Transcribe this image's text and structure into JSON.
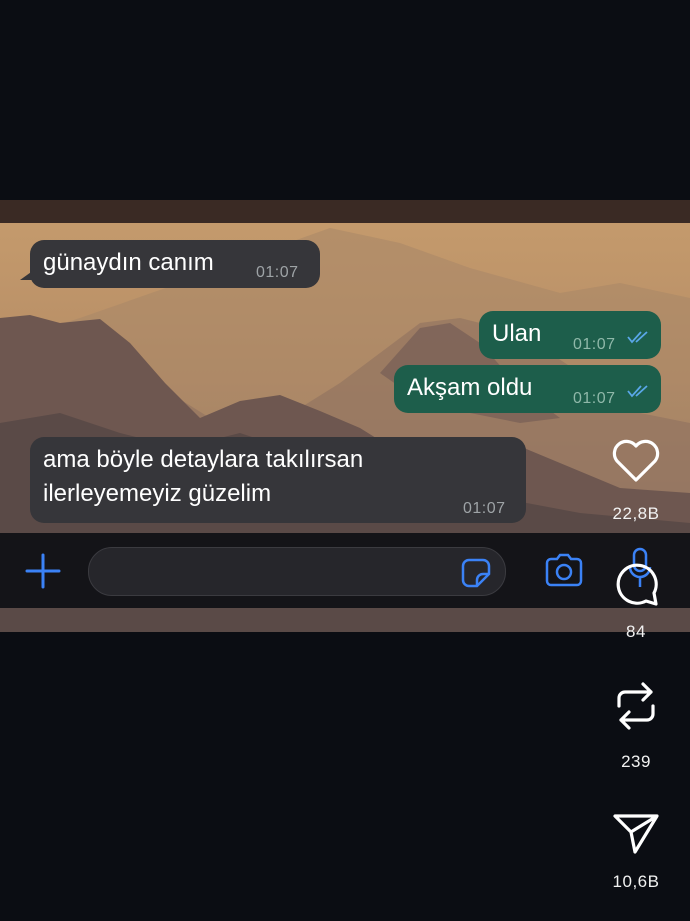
{
  "chat": {
    "messages": [
      {
        "direction": "incoming",
        "text": "günaydın canım",
        "time": "01:07"
      },
      {
        "direction": "outgoing",
        "text": "Ulan",
        "time": "01:07"
      },
      {
        "direction": "outgoing",
        "text": "Akşam oldu",
        "time": "01:07"
      },
      {
        "direction": "incoming",
        "line1": "ama böyle detaylara takılırsan",
        "line2": "ilerleyemeyiz güzelim",
        "time": "01:07"
      }
    ]
  },
  "input_bar": {
    "icons": [
      "plus-icon",
      "sticker-icon",
      "camera-icon",
      "microphone-icon"
    ],
    "accent_color": "#3b82f6"
  },
  "actions": {
    "like": {
      "icon": "heart-icon",
      "count": "22,8B"
    },
    "reply": {
      "icon": "comment-icon",
      "count": "84"
    },
    "repost": {
      "icon": "repost-icon",
      "count": "239"
    },
    "share": {
      "icon": "send-icon",
      "count": "10,6B"
    }
  }
}
